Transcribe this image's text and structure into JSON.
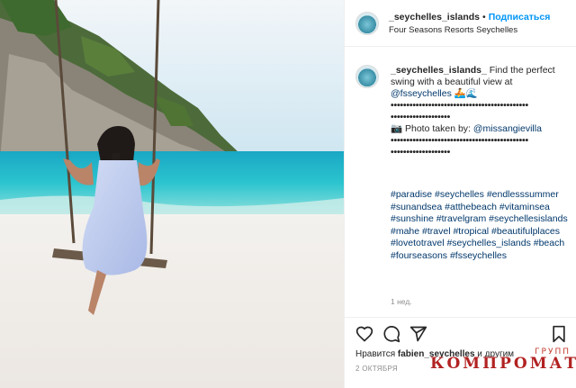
{
  "header": {
    "username": "_seychelles_islands",
    "separator": "•",
    "follow_label": "Подписаться",
    "location": "Four Seasons Resorts Seychelles"
  },
  "caption": {
    "username": "_seychelles_islands_",
    "text": " Find the perfect swing with a beautiful view at ",
    "mention": "@fsseychelles",
    "emoji": "🚣🌊",
    "dots_1": "••••••••••••••••••••••••••••••••••••••••••••",
    "dots_2": "•••••••••••••••••••",
    "credit_icon": "📷",
    "credit_text": " Photo taken by: ",
    "credit_mention": "@missangievilla",
    "dots_3": "••••••••••••••••••••••••••••••••••••••••••••",
    "dots_4": "•••••••••••••••••••"
  },
  "hashtags": "#paradise #seychelles #endlesssummer #sunandsea #atthebeach #vitaminsea #sunshine #travelgram #seychellesislands #mahe #travel #tropical #beautifulplaces #lovetotravel #seychelles_islands #beach #fourseasons #fsseychelles",
  "time_ago": "1 нед.",
  "likes": {
    "prefix": "Нравится ",
    "user": "fabien_seychelles",
    "suffix": " и другим"
  },
  "date": "2 ОКТЯБРЯ",
  "watermark": {
    "small": "ГРУПП",
    "big": "КОМПРОМАТ"
  },
  "icons": [
    "heart-icon",
    "comment-icon",
    "share-icon",
    "bookmark-icon"
  ]
}
